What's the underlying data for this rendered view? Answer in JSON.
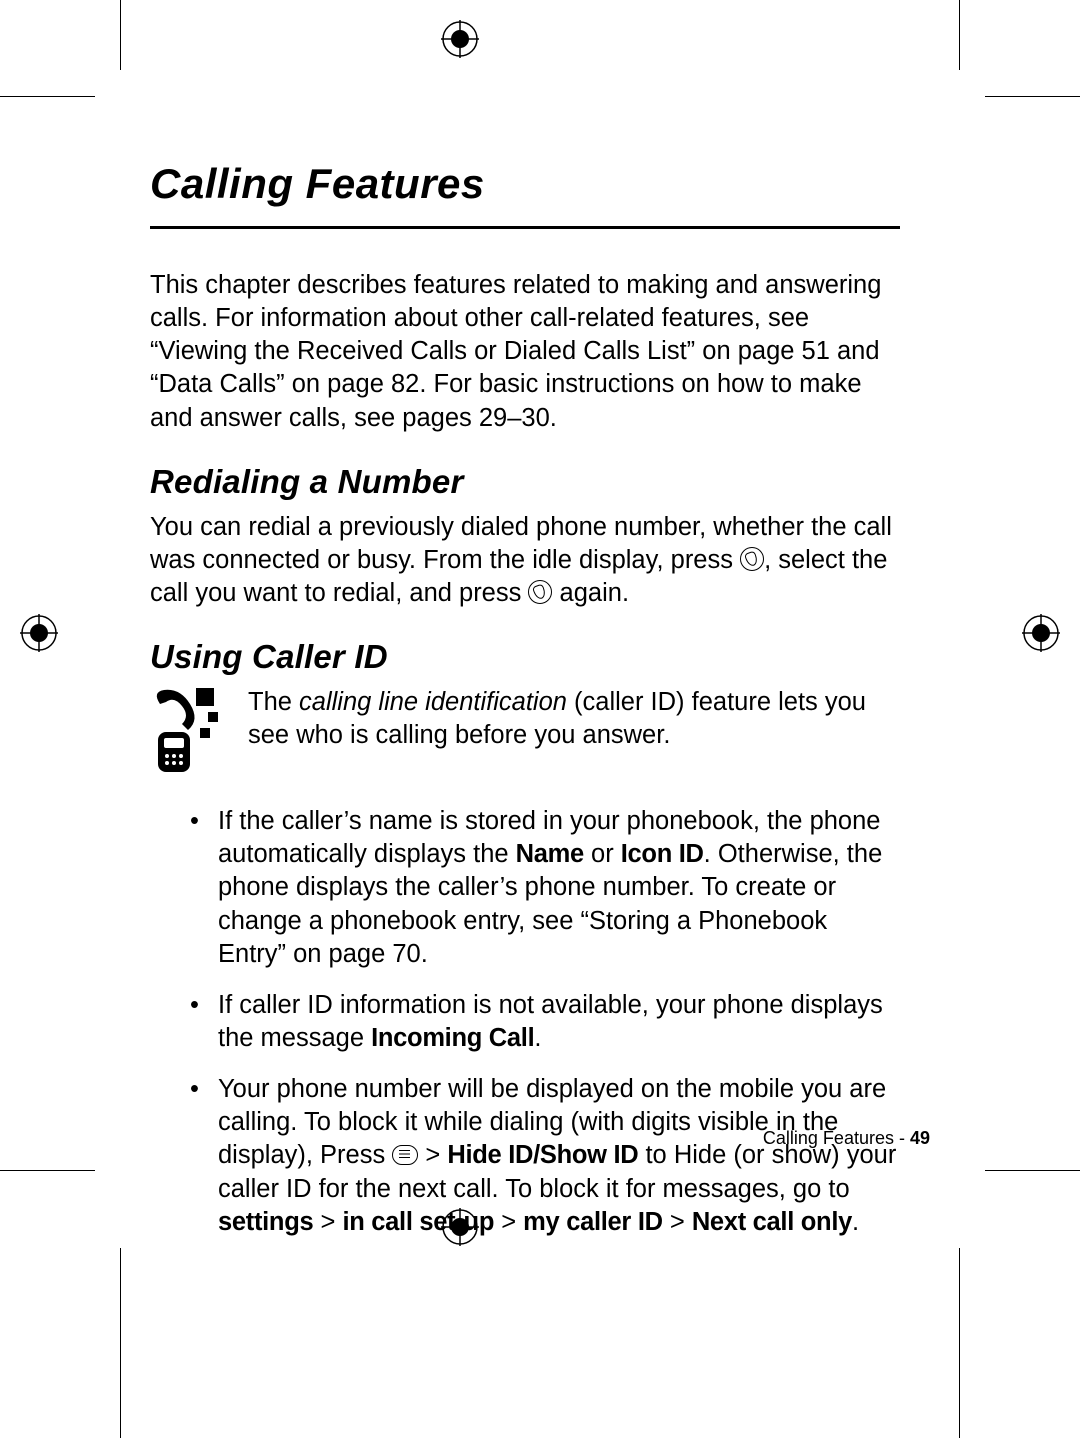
{
  "chapter_title": "Calling Features",
  "intro": "This chapter describes features related to making and answering calls. For information about other call-related features, see “Viewing the Received Calls or Dialed Calls List” on page 51 and “Data Calls” on page 82. For basic instructions on how to make and answer calls, see pages 29–30.",
  "sections": {
    "redial": {
      "title": "Redialing a Number",
      "p1a": "You can redial a previously dialed phone number, whether the call was connected or busy. From the idle display, press ",
      "p1b": ", select the call you want to redial, and press ",
      "p1c": " again."
    },
    "callerid": {
      "title": "Using Caller ID",
      "lead_a": "The ",
      "lead_em": "calling line identification",
      "lead_b": " (caller ID) feature lets you see who is calling before you answer.",
      "b1_a": "If the caller’s name is stored in your phonebook, the phone automatically displays the ",
      "b1_name": "Name",
      "b1_or": " or ",
      "b1_iconid": "Icon ID",
      "b1_b": ". Otherwise, the phone displays the caller’s phone number. To create or change a phonebook entry, see “Storing a Phonebook Entry” on page 70.",
      "b2_a": "If caller ID information is not available, your phone displays the message ",
      "b2_incoming": "Incoming Call",
      "b2_b": ".",
      "b3_a": "Your phone number will be displayed on the mobile you are calling. To block it while dialing (with digits visible in the display), Press ",
      "b3_gt1": " > ",
      "b3_hideshow": "Hide ID/Show ID",
      "b3_b": " to Hide (or show) your caller ID for the next call. To block it for messages, go to ",
      "b3_settings": "settings",
      "b3_gt2": " > ",
      "b3_incall": "in call set-up",
      "b3_gt3": " > ",
      "b3_mycid": "my caller ID",
      "b3_gt4": " > ",
      "b3_nextonly": "Next call only",
      "b3_c": "."
    }
  },
  "footer": {
    "label": "Calling Features - ",
    "page": "49"
  }
}
